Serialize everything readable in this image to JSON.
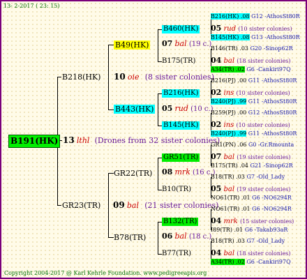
{
  "header": {
    "date": "13-  2-2017 ( 23: 15)",
    "copyright": "Copyright 2004-2017 @ Karl Kehrle Foundation.   www.pedigreeapis.org"
  },
  "root": {
    "id": "B191(HK)",
    "num": "13",
    "breed": "lthl",
    "note": "(Drones from 32 sister colonies)"
  },
  "gen2": {
    "upper": {
      "id": "B218(HK)",
      "num": "10",
      "breed": "oie",
      "note": "(8 sister colonies)"
    },
    "lower": {
      "id": "GR23(TR)",
      "num": "09",
      "breed": "bal",
      "note": "(21 sister colonies)"
    }
  },
  "gen3": {
    "a": {
      "id": "B49(HK)",
      "num": "07",
      "breed": "bal",
      "note": "(19 c.)"
    },
    "b": {
      "id": "B443(HK)",
      "num": "05",
      "breed": "rud",
      "note": "(10 c.)"
    },
    "c": {
      "id": "GR22(TR)",
      "num": "08",
      "breed": "mrk",
      "note": "(16 c.)"
    },
    "d": {
      "id": "B78(TR)",
      "num": "06",
      "breed": "bal",
      "note": "(18 c.)"
    }
  },
  "gen4": {
    "a1": {
      "id": "B460(HK)",
      "num": "05",
      "breed": "rud",
      "note": "(10 sister colonies)"
    },
    "a2": {
      "id": "B175(TR)",
      "num": "04",
      "breed": "bal",
      "note": "(18 sister colonies)"
    },
    "b1": {
      "id": "B216(HK)",
      "num": "02",
      "breed": "ins",
      "note": "(10 sister colonies)"
    },
    "b2": {
      "id": "B145(HK)",
      "num": "02",
      "breed": "ins",
      "note": "(10 sister colonies)"
    },
    "c1": {
      "id": "GR51(TR)",
      "num": "07",
      "breed": "bal",
      "note": "(19 sister colonies)"
    },
    "c2": {
      "id": "B10(TR)",
      "num": "05",
      "breed": "bal",
      "note": "(19 sister colonies)"
    },
    "d1": {
      "id": "B132(TR)",
      "num": "04",
      "breed": "mrk",
      "note": "(15 sister colonies)"
    },
    "d2": {
      "id": "B77(TR)",
      "num": "04",
      "breed": "bal",
      "note": "(18 sister colonies)"
    }
  },
  "gen5": [
    {
      "id": "B216(HK) .08",
      "code": "G12 -AthosSt80R"
    },
    {
      "id": "B145(HK) .08",
      "code": "G13 -AthosSt80R"
    },
    {
      "id": "B146(TR) .03",
      "code": "G20 -Sinop62R"
    },
    {
      "id": "A34(TR) .02",
      "code": "G6 -Cankiri97Q"
    },
    {
      "id": "B216(PJ) .00",
      "code": "G11 -AthosSt80R"
    },
    {
      "id": "B240(PJ) .99",
      "code": "G11 -AthosSt80R"
    },
    {
      "id": "B259(PJ) .00",
      "code": "G12 -AthosSt80R"
    },
    {
      "id": "B240(PJ) .99",
      "code": "G11 -AthosSt80R"
    },
    {
      "id": "GR1(PN) .06",
      "code": "G0 -Gr.Rmounta"
    },
    {
      "id": "B175(TR) .04",
      "code": "G21 -Sinop62R"
    },
    {
      "id": "B18(TR) .03",
      "code": "G7 -Old_Lady"
    },
    {
      "id": "NO61(TR) .01",
      "code": "G6 -NO6294R"
    },
    {
      "id": "NO61(TR) .01",
      "code": "G6 -NO6294R"
    },
    {
      "id": "I89(TR) .01",
      "code": "G6 -Takab93aR"
    },
    {
      "id": "B18(TR) .03",
      "code": "G7 -Old_Lady"
    },
    {
      "id": "A34(TR) .02",
      "code": "G6 -Cankiri97Q"
    }
  ]
}
